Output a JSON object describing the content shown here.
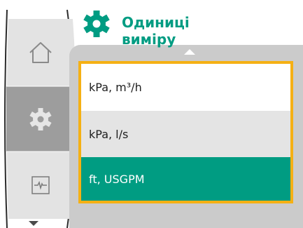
{
  "header": {
    "title": "Одиниці виміру",
    "icon": "gear-icon"
  },
  "nav": {
    "items": [
      {
        "name": "home",
        "icon": "home-icon",
        "active": false
      },
      {
        "name": "settings",
        "icon": "gear-icon",
        "active": true
      },
      {
        "name": "diagnostics",
        "icon": "pulse-monitor-icon",
        "active": false
      }
    ],
    "more_icon": "scroll-down-icon"
  },
  "units_list": {
    "scroll_up_icon": "scroll-up-icon",
    "selected_index": 2,
    "options": [
      {
        "label": "kPa, m³/h"
      },
      {
        "label": "kPa, l/s"
      },
      {
        "label": "ft, USGPM"
      }
    ]
  },
  "colors": {
    "brand_green": "#009c82",
    "focus_yellow": "#f5b014",
    "panel_grey": "#cbcbcb",
    "rail_grey": "#e3e3e3",
    "rail_active_grey": "#9d9d9d"
  }
}
